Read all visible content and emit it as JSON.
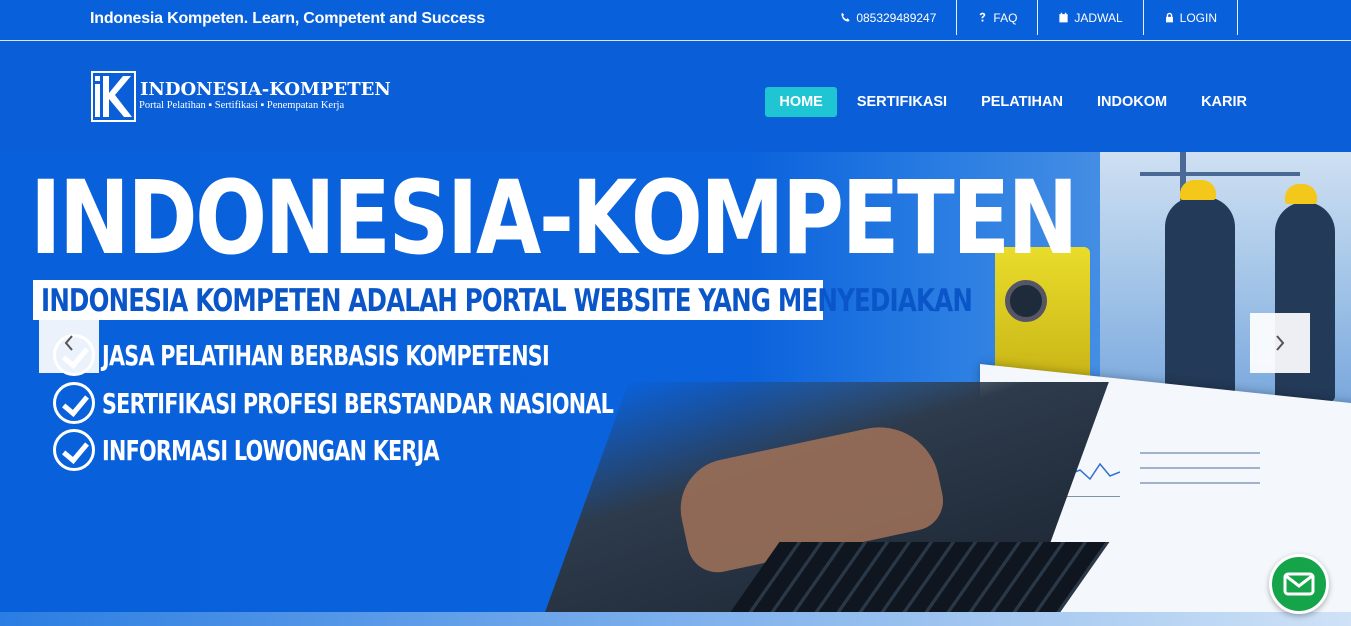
{
  "topbar": {
    "tagline": "Indonesia Kompeten. Learn, Competent and Success",
    "links": [
      {
        "label": "085329489247",
        "icon": "phone-icon"
      },
      {
        "label": "FAQ",
        "icon": "question-icon"
      },
      {
        "label": "JADWAL",
        "icon": "calendar-icon"
      },
      {
        "label": "LOGIN",
        "icon": "lock-icon"
      }
    ]
  },
  "logo": {
    "title": "INDONESIA-KOMPETEN",
    "subtitle": "Portal Pelatihan ▪ Sertifikasi ▪ Penempatan Kerja"
  },
  "nav": {
    "items": [
      {
        "label": "HOME",
        "active": true
      },
      {
        "label": "SERTIFIKASI",
        "active": false
      },
      {
        "label": "PELATIHAN",
        "active": false
      },
      {
        "label": "INDOKOM",
        "active": false
      },
      {
        "label": "KARIR",
        "active": false
      }
    ]
  },
  "hero": {
    "title": "INDONESIA-KOMPETEN",
    "banner": "INDONESIA KOMPETEN ADALAH PORTAL WEBSITE YANG MENYEDIAKAN",
    "bullets": [
      "JASA PELATIHAN BERBASIS KOMPETENSI",
      "SERTIFIKASI PROFESI BERSTANDAR NASIONAL",
      "INFORMASI LOWONGAN KERJA"
    ]
  },
  "carousel": {
    "prev_icon": "chevron-left-icon",
    "next_icon": "chevron-right-icon"
  },
  "chat": {
    "icon": "mail-icon"
  },
  "colors": {
    "background": "#0a5fd9",
    "nav_active": "#20c5d4",
    "chat_button": "#15a44a"
  }
}
